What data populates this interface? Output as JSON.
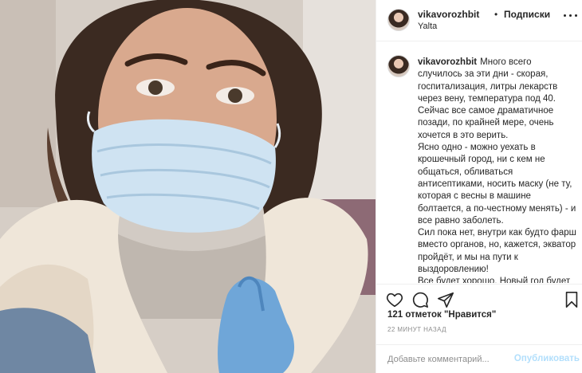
{
  "post": {
    "username": "vikavorozhbit",
    "separator": "•",
    "follow_label": "Подписки",
    "location": "Yalta",
    "caption_lines": [
      "Много всего случилось за эти дни - скорая, госпитализация, литры лекарств через вену, температура под 40.",
      "Сейчас все самое драматичное позади, по крайней мере, очень хочется в это верить.",
      "Ясно одно - можно уехать в крошечный город, ни с кем не общаться, обливаться антисептиками, носить маску (не ту, которая с весны в машине болтается, а по-честному менять) - и все равно заболеть.",
      "Сил пока нет, внутри как будто фарш вместо органов, но, кажется, экватор пройдёт, и мы на пути к выздоровлению!",
      "Все будет хорошо. Новый год будет лучше)"
    ],
    "likes_text": "121 отметок \"Нравится\"",
    "time_text": "22 минут назад",
    "comment_placeholder": "Добавьте комментарий...",
    "publish_label": "Опубликовать"
  },
  "icons": {
    "more": "more-horizontal-icon",
    "like": "heart-icon",
    "comment": "comment-icon",
    "share": "share-icon",
    "save": "bookmark-icon"
  },
  "colors": {
    "text": "#262626",
    "muted": "#8e8e8e",
    "border": "#efefef",
    "publish_disabled": "#b2dffc"
  }
}
